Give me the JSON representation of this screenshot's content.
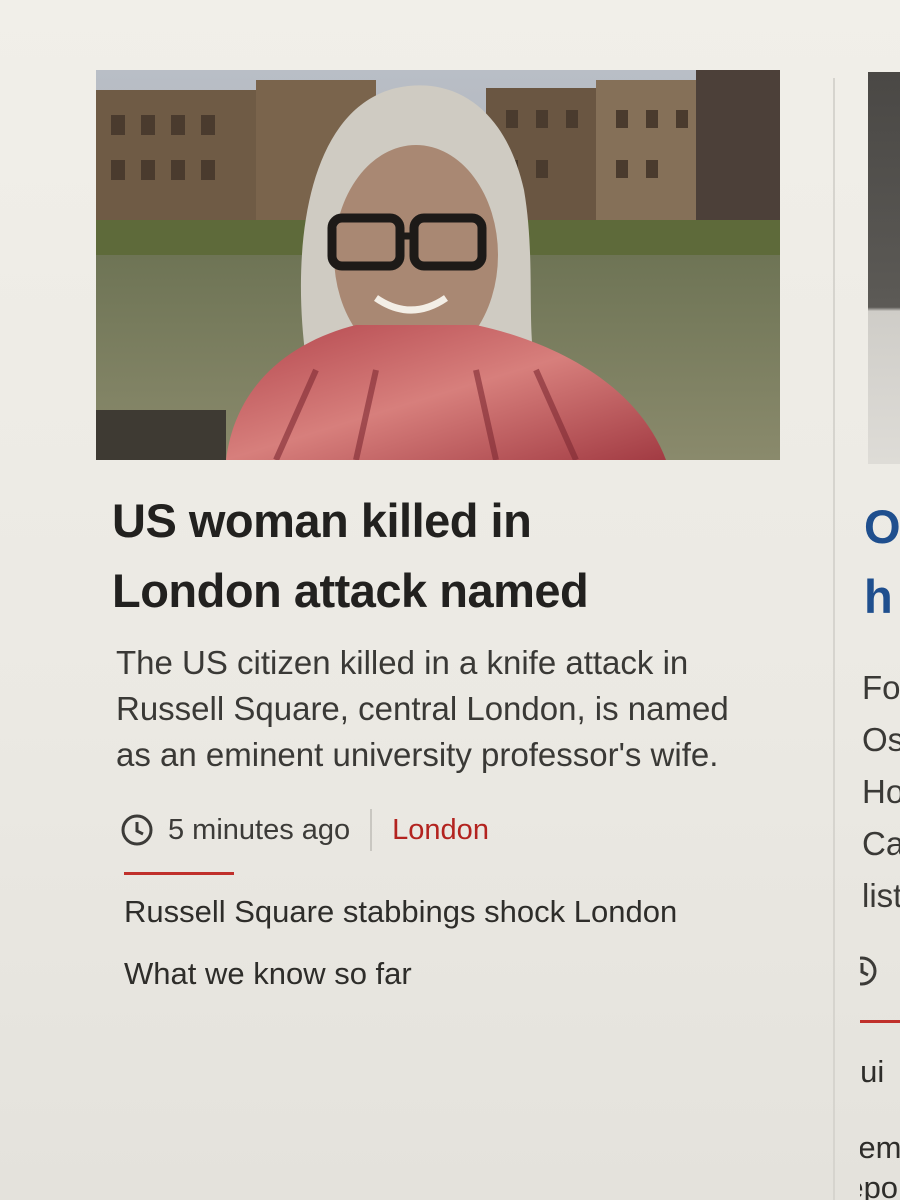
{
  "main_story": {
    "image_alt": "woman with grey hair and glasses beside a river",
    "headline_line1": "US woman killed in",
    "headline_line2": "London attack named",
    "summary": "The US citizen killed in a knife attack in Russell Square, central London, is named as an eminent university professor's wife.",
    "timestamp": "5 minutes ago",
    "section": "London",
    "clock_icon": "clock-icon",
    "related": [
      {
        "label": "Russell Square stabbings shock London"
      },
      {
        "label": "What we know so far"
      }
    ]
  },
  "side_story": {
    "headline_line1": "O",
    "headline_line2": "h",
    "summary_lines": [
      "Fo",
      "Os",
      "Ho",
      "Ca",
      "list."
    ],
    "clock_icon": "clock-icon",
    "related_line1": "Gui",
    "related_line2": "Rem",
    "related_line3": "repo"
  },
  "colors": {
    "headline_side": "#1f4f8e",
    "section_link": "#b3231f",
    "accent_rule": "#c0302b"
  }
}
